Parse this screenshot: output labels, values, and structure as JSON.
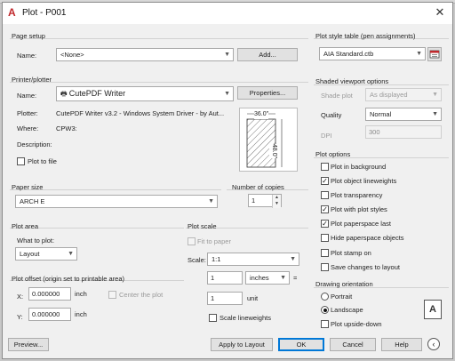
{
  "window": {
    "title": "Plot - P001",
    "close_glyph": "✕"
  },
  "page_setup": {
    "group_title": "Page setup",
    "name_label": "Name:",
    "name_value": "<None>",
    "add_button": "Add..."
  },
  "printer": {
    "group_title": "Printer/plotter",
    "name_label": "Name:",
    "name_value": "CutePDF Writer",
    "properties_button": "Properties...",
    "plotter_label": "Plotter:",
    "plotter_value": "CutePDF Writer v3.2 - Windows System Driver - by Aut...",
    "where_label": "Where:",
    "where_value": "CPW3:",
    "description_label": "Description:",
    "plot_to_file_label": "Plot to file",
    "preview_width": "36.0\"",
    "preview_height": "48.0\""
  },
  "paper_size": {
    "group_title": "Paper size",
    "value": "ARCH E"
  },
  "copies": {
    "group_title": "Number of copies",
    "value": "1"
  },
  "plot_area": {
    "group_title": "Plot area",
    "what_label": "What to plot:",
    "what_value": "Layout"
  },
  "plot_offset": {
    "group_title": "Plot offset (origin set to printable area)",
    "x_label": "X:",
    "x_value": "0.000000",
    "x_unit": "inch",
    "y_label": "Y:",
    "y_value": "0.000000",
    "y_unit": "inch",
    "center_label": "Center the plot"
  },
  "plot_scale": {
    "group_title": "Plot scale",
    "fit_label": "Fit to paper",
    "scale_label": "Scale:",
    "scale_value": "1:1",
    "value1": "1",
    "unit1": "inches",
    "equals": "=",
    "value2": "1",
    "unit2": "unit",
    "lineweights_label": "Scale lineweights"
  },
  "plot_style": {
    "group_title": "Plot style table (pen assignments)",
    "value": "AIA Standard.ctb"
  },
  "shaded": {
    "group_title": "Shaded viewport options",
    "shade_label": "Shade plot",
    "shade_value": "As displayed",
    "quality_label": "Quality",
    "quality_value": "Normal",
    "dpi_label": "DPI",
    "dpi_value": "300"
  },
  "plot_options": {
    "group_title": "Plot options",
    "items": [
      {
        "label": "Plot in background",
        "checked": false
      },
      {
        "label": "Plot object lineweights",
        "checked": true
      },
      {
        "label": "Plot transparency",
        "checked": false
      },
      {
        "label": "Plot with plot styles",
        "checked": true
      },
      {
        "label": "Plot paperspace last",
        "checked": true
      },
      {
        "label": "Hide paperspace objects",
        "checked": false
      },
      {
        "label": "Plot stamp on",
        "checked": false
      },
      {
        "label": "Save changes to layout",
        "checked": false
      }
    ]
  },
  "orientation": {
    "group_title": "Drawing orientation",
    "portrait": "Portrait",
    "landscape": "Landscape",
    "upside_down": "Plot upside-down",
    "selected": "landscape"
  },
  "footer": {
    "preview": "Preview...",
    "apply": "Apply to Layout",
    "ok": "OK",
    "cancel": "Cancel",
    "help": "Help"
  },
  "colors": {
    "accent": "#0078d7",
    "title_icon": "#c0282c"
  }
}
